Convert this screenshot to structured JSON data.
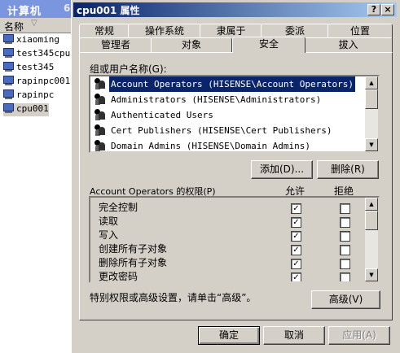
{
  "background": {
    "title": "计算机",
    "title_suffix": "6",
    "column_header": "名称",
    "items": [
      "xiaoming",
      "test345cpu",
      "test345",
      "rapinpc001",
      "rapinpc",
      "cpu001"
    ]
  },
  "dialog": {
    "title": "cpu001 属性",
    "help_button": "?",
    "close_button": "×"
  },
  "tabs": {
    "row1": [
      "常规",
      "操作系统",
      "隶属于",
      "委派",
      "位置"
    ],
    "row2": [
      "管理者",
      "对象",
      "安全",
      "拔入"
    ]
  },
  "users": {
    "label": "组或用户名称(G):",
    "list": [
      "Account Operators (HISENSE\\Account Operators)",
      "Administrators (HISENSE\\Administrators)",
      "Authenticated Users",
      "Cert Publishers (HISENSE\\Cert Publishers)",
      "Domain Admins (HISENSE\\Domain Admins)"
    ],
    "add_button": "添加(D)...",
    "remove_button": "删除(R)"
  },
  "permissions": {
    "label": "Account Operators 的权限(P)",
    "allow_header": "允许",
    "deny_header": "拒绝",
    "rows": [
      {
        "name": "完全控制",
        "allow": true,
        "deny": false
      },
      {
        "name": "读取",
        "allow": true,
        "deny": false
      },
      {
        "name": "写入",
        "allow": true,
        "deny": false
      },
      {
        "name": "创建所有子对象",
        "allow": true,
        "deny": false
      },
      {
        "name": "删除所有子对象",
        "allow": true,
        "deny": false
      },
      {
        "name": "更改密码",
        "allow": true,
        "deny": false
      }
    ]
  },
  "advanced": {
    "hint": "特别权限或高级设置，请单击“高级”。",
    "button": "高级(V)"
  },
  "footer": {
    "ok": "确定",
    "cancel": "取消",
    "apply": "应用(A)"
  },
  "checkmark": "✓",
  "colors": {
    "title_start": "#0a246a",
    "title_end": "#a6caf0",
    "selection": "#0a246a",
    "face": "#d4d0c8"
  }
}
